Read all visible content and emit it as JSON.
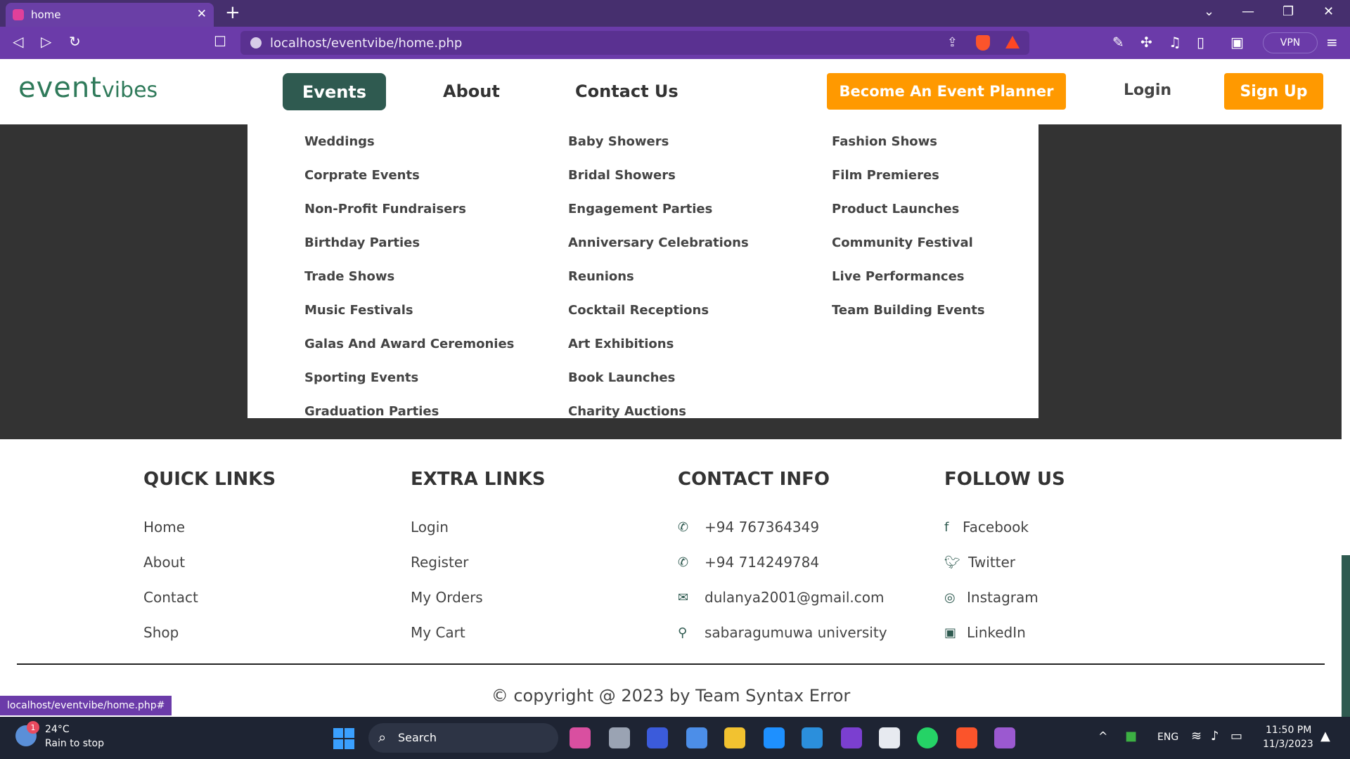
{
  "browser": {
    "tab_title": "home",
    "tab_close": "✕",
    "new_tab": "+",
    "url": "localhost/eventvibe/home.php",
    "vpn_label": "VPN",
    "status_link": "localhost/eventvibe/home.php#"
  },
  "header": {
    "logo_main": "event",
    "logo_sub": "vibes",
    "nav": {
      "events": "Events",
      "about": "About",
      "contact": "Contact Us"
    },
    "planner_button": "Become An Event Planner",
    "login": "Login",
    "signup": "Sign Up"
  },
  "menu": {
    "col1": [
      "Weddings",
      "Corprate Events",
      "Non-Profit Fundraisers",
      "Birthday Parties",
      "Trade Shows",
      "Music Festivals",
      "Galas And Award Ceremonies",
      "Sporting Events",
      "Graduation Parties"
    ],
    "col2": [
      "Baby Showers",
      "Bridal Showers",
      "Engagement Parties",
      "Anniversary Celebrations",
      "Reunions",
      "Cocktail Receptions",
      "Art Exhibitions",
      "Book Launches",
      "Charity Auctions"
    ],
    "col3": [
      "Fashion Shows",
      "Film Premieres",
      "Product Launches",
      "Community Festival",
      "Live Performances",
      "Team Building Events"
    ]
  },
  "footer": {
    "quick_links": {
      "heading": "QUICK LINKS",
      "items": [
        "Home",
        "About",
        "Contact",
        "Shop"
      ]
    },
    "extra_links": {
      "heading": "EXTRA LINKS",
      "items": [
        "Login",
        "Register",
        "My Orders",
        "My Cart"
      ]
    },
    "contact_info": {
      "heading": "CONTACT INFO",
      "items": [
        "+94 767364349",
        "+94 714249784",
        "dulanya2001@gmail.com",
        "sabaragumuwa university"
      ]
    },
    "follow_us": {
      "heading": "FOLLOW US",
      "items": [
        "Facebook",
        "Twitter",
        "Instagram",
        "LinkedIn"
      ]
    },
    "copyright": "© copyright @ 2023 by Team Syntax Error"
  },
  "taskbar": {
    "weather_badge": "1",
    "weather_temp": "24°C",
    "weather_desc": "Rain to stop",
    "search_label": "Search",
    "language": "ENG",
    "time": "11:50 PM",
    "date": "11/3/2023"
  },
  "colors": {
    "brand_green": "#2f5a50",
    "accent_orange": "#ff9900",
    "browser_purple": "#6b3ba9"
  }
}
